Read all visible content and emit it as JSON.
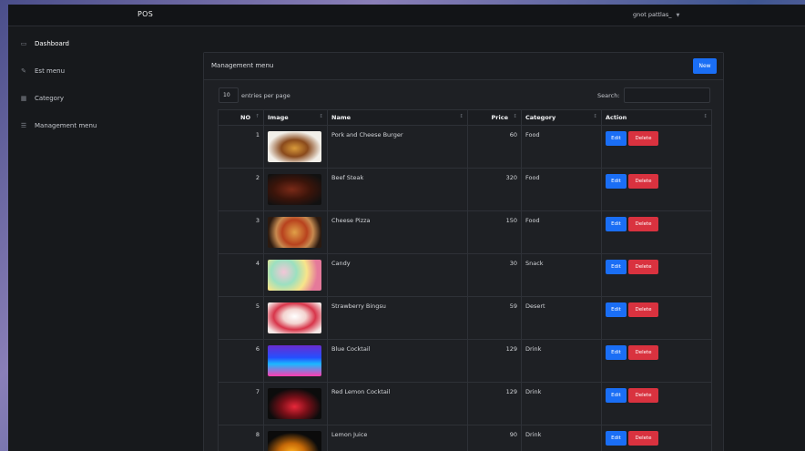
{
  "app": {
    "brand": "POS",
    "user": "gnot pattlas_"
  },
  "sidebar": {
    "items": [
      {
        "label": "Dashboard",
        "icon": "dashboard-icon"
      },
      {
        "label": "Est menu",
        "icon": "pencil-icon"
      },
      {
        "label": "Category",
        "icon": "grid-icon"
      },
      {
        "label": "Management menu",
        "icon": "list-icon"
      }
    ]
  },
  "card": {
    "title": "Management menu",
    "new_label": "New"
  },
  "controls": {
    "page_length": "10",
    "length_label": "entries per page",
    "search_label": "Search:"
  },
  "table": {
    "headers": [
      "NO",
      "Image",
      "Name",
      "Price",
      "Category",
      "Action"
    ],
    "rows": [
      {
        "no": "1",
        "name": "Pork and Cheese Burger",
        "price": "60",
        "category": "Food",
        "image": "burger"
      },
      {
        "no": "2",
        "name": "Beef Steak",
        "price": "320",
        "category": "Food",
        "image": "steak"
      },
      {
        "no": "3",
        "name": "Cheese Pizza",
        "price": "150",
        "category": "Food",
        "image": "pizza"
      },
      {
        "no": "4",
        "name": "Candy",
        "price": "30",
        "category": "Snack",
        "image": "candy"
      },
      {
        "no": "5",
        "name": "Strawberry Bingsu",
        "price": "59",
        "category": "Desert",
        "image": "bingsu"
      },
      {
        "no": "6",
        "name": "Blue Cocktail",
        "price": "129",
        "category": "Drink",
        "image": "blue-cocktail"
      },
      {
        "no": "7",
        "name": "Red Lemon Cocktail",
        "price": "129",
        "category": "Drink",
        "image": "red-cocktail"
      },
      {
        "no": "8",
        "name": "Lemon Juice",
        "price": "90",
        "category": "Drink",
        "image": "lemon-juice"
      }
    ],
    "edit_label": "Edit",
    "delete_label": "Delete"
  },
  "colors": {
    "primary": "#1a6ef5",
    "danger": "#d9323f",
    "background": "#17191c"
  }
}
